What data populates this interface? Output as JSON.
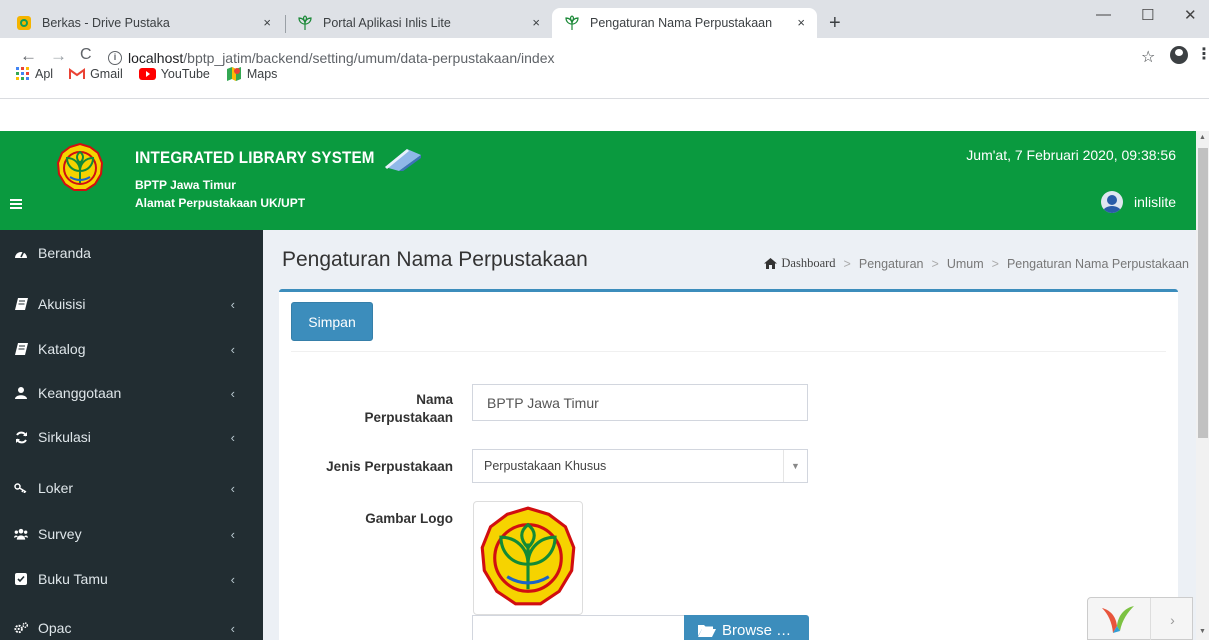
{
  "browser": {
    "tabs": [
      {
        "title": "Berkas - Drive Pustaka",
        "close": "×"
      },
      {
        "title": "Portal Aplikasi Inlis Lite",
        "close": "×"
      },
      {
        "title": "Pengaturan Nama Perpustakaan",
        "close": "×"
      }
    ],
    "new_tab": "+",
    "window_controls": {
      "minimize": "—",
      "maximize": "☐",
      "close": "✕"
    },
    "nav": {
      "back": "←",
      "forward": "→",
      "reload": "C"
    },
    "url": {
      "host": "localhost",
      "path": "/bptp_jatim/backend/setting/umum/data-perpustakaan/index"
    },
    "star": "☆",
    "menu": "⋮",
    "bookmarks": [
      {
        "label": "Apl",
        "icon": "apps-grid-icon"
      },
      {
        "label": "Gmail",
        "icon": "gmail-icon"
      },
      {
        "label": "YouTube",
        "icon": "youtube-icon"
      },
      {
        "label": "Maps",
        "icon": "maps-icon"
      }
    ]
  },
  "header": {
    "app_title": "INTEGRATED LIBRARY SYSTEM",
    "institution": "BPTP Jawa Timur",
    "address": "Alamat Perpustakaan UK/UPT",
    "datetime": "Jum'at, 7 Februari 2020, 09:38:56",
    "username": "inlislite",
    "colors": {
      "brand": "#0a9a3f",
      "accent": "#3c8dbc",
      "sidebar": "#222d32"
    }
  },
  "sidebar": {
    "items": [
      {
        "label": "Beranda",
        "icon": "dashboard-icon",
        "chevron": ""
      },
      {
        "label": "Akuisisi",
        "icon": "book-icon",
        "chevron": "‹"
      },
      {
        "label": "Katalog",
        "icon": "book-icon",
        "chevron": "‹"
      },
      {
        "label": "Keanggotaan",
        "icon": "user-icon",
        "chevron": "‹"
      },
      {
        "label": "Sirkulasi",
        "icon": "refresh-icon",
        "chevron": "‹"
      },
      {
        "label": "Loker",
        "icon": "key-icon",
        "chevron": "‹"
      },
      {
        "label": "Survey",
        "icon": "users-icon",
        "chevron": "‹"
      },
      {
        "label": "Buku Tamu",
        "icon": "check-square-icon",
        "chevron": "‹"
      },
      {
        "label": "Opac",
        "icon": "cogs-icon",
        "chevron": "‹"
      }
    ]
  },
  "page": {
    "title": "Pengaturan Nama Perpustakaan",
    "breadcrumb": [
      "Dashboard",
      "Pengaturan",
      "Umum",
      "Pengaturan Nama Perpustakaan"
    ],
    "breadcrumb_sep": ">",
    "save_label": "Simpan"
  },
  "form": {
    "name_label_line1": "Nama",
    "name_label_line2": "Perpustakaan",
    "name_value": "BPTP Jawa Timur",
    "type_label": "Jenis Perpustakaan",
    "type_value": "Perpustakaan Khusus",
    "type_caret": "▼",
    "logo_label": "Gambar Logo",
    "browse_label": "Browse …"
  },
  "debug": {
    "chevron": "›"
  }
}
